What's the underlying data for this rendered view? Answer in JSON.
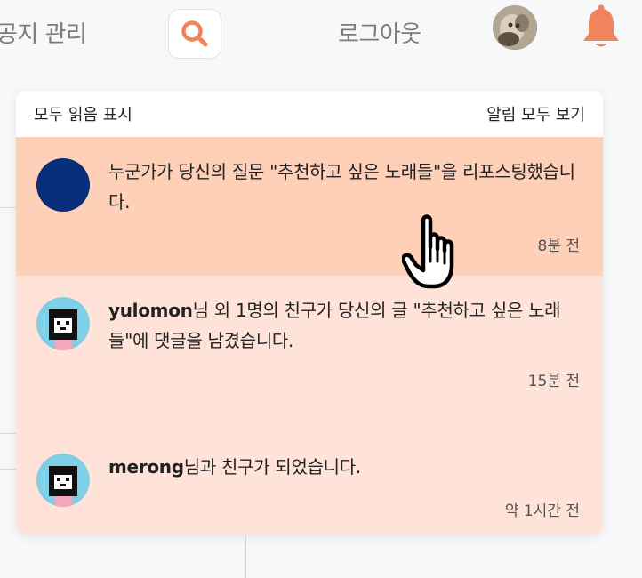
{
  "header": {
    "notice_label": "공지 관리",
    "logout_label": "로그아웃",
    "search_icon": "search-icon",
    "bell_icon": "bell-icon",
    "accent_color": "#f0845c"
  },
  "dropdown": {
    "mark_all_read": "모두 읽음 표시",
    "view_all": "알림 모두 보기",
    "items": [
      {
        "user": "",
        "message": "누군가가 당신의 질문 \"추천하고 싶은 노래들\"을 리포스팅했습니다.",
        "time": "8분 전",
        "active": true
      },
      {
        "user": "yulomon",
        "message": "님 외 1명의 친구가 당신의 글 \"추천하고 싶은 노래들\"에 댓글을 남겼습니다.",
        "time": "15분 전"
      },
      {
        "user": "merong",
        "message": "님과 친구가 되었습니다.",
        "time": "약 1시간 전"
      }
    ]
  }
}
